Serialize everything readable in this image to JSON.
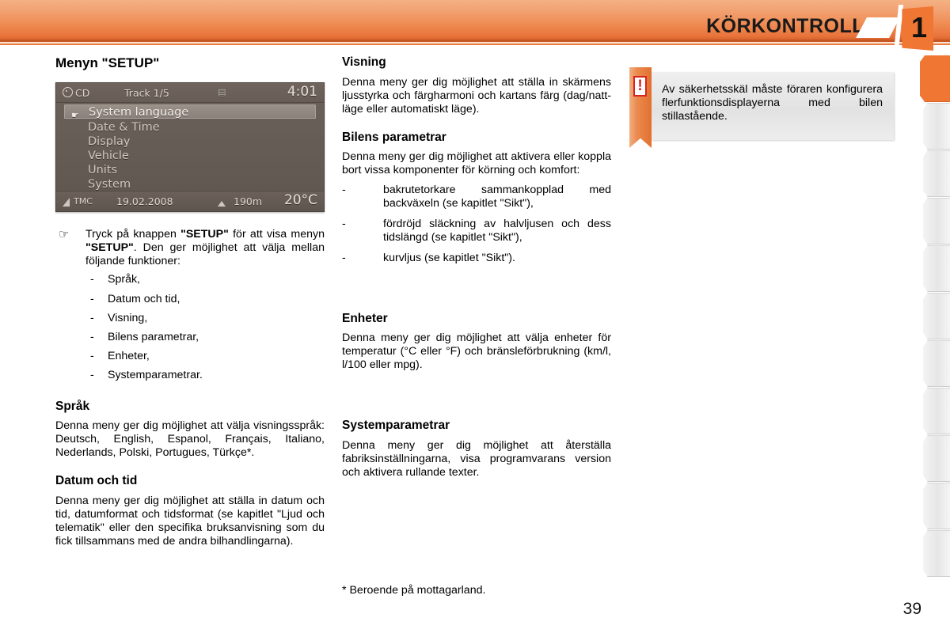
{
  "header": {
    "title": "KÖRKONTROLL",
    "chapter_number": "1",
    "accent_color": "#ef7733"
  },
  "left_column": {
    "heading": "Menyn \"SETUP\"",
    "screen": {
      "topbar": {
        "source": "CD",
        "track": "Track 1/5",
        "time": "4:01"
      },
      "menu_items": [
        "System language",
        "Date & Time",
        "Display",
        "Vehicle",
        "Units",
        "System"
      ],
      "selected_index": 0,
      "statusbar": {
        "tmc": "TMC",
        "date": "19.02.2008",
        "altitude": "190m",
        "temperature": "20°C"
      }
    },
    "pointer_paragraph": {
      "icon": "pointing-hand-icon",
      "text_parts": [
        {
          "text": "Tryck på knappen ",
          "bold": false
        },
        {
          "text": "\"SETUP\"",
          "bold": true
        },
        {
          "text": " för att visa menyn ",
          "bold": false
        },
        {
          "text": "\"SETUP\"",
          "bold": true
        },
        {
          "text": ". Den ger möjlighet att välja mellan följande funktioner:",
          "bold": false
        }
      ],
      "plain_text": "Tryck på knappen \"SETUP\" för att visa menyn \"SETUP\". Den ger möjlighet att välja mellan följande funktioner:"
    },
    "function_list": [
      "Språk,",
      "Datum och tid,",
      "Visning,",
      "Bilens parametrar,",
      "Enheter,",
      "Systemparametrar."
    ],
    "sections": [
      {
        "heading": "Språk",
        "body": "Denna meny ger dig möjlighet att välja visningsspråk: Deutsch, English, Espanol, Français, Italiano, Nederlands, Polski, Portugues, Türkçe*."
      },
      {
        "heading": "Datum och tid",
        "body": "Denna meny ger dig möjlighet att ställa in datum och tid, datumformat och tidsformat (se kapitlet \"Ljud och telematik\" eller den specifika bruksanvisning som du fick tillsammans med de andra bilhandlingarna)."
      }
    ]
  },
  "middle_column": {
    "sections": [
      {
        "heading": "Visning",
        "body": "Denna meny ger dig möjlighet att ställa in skärmens ljusstyrka och färgharmoni och kartans färg (dag/natt-läge eller automatiskt läge)."
      },
      {
        "heading": "Bilens parametrar",
        "body": "Denna meny ger dig möjlighet att aktivera eller koppla bort vissa komponenter för körning och komfort:",
        "list": [
          "bakrutetorkare sammankopplad med backväxeln (se kapitlet \"Sikt\"),",
          "fördröjd släckning av halvljusen och dess tidslängd (se kapitlet \"Sikt\"),",
          "kurvljus (se kapitlet \"Sikt\")."
        ]
      },
      {
        "heading": "Enheter",
        "body": "Denna meny ger dig möjlighet att välja enheter för temperatur (°C eller °F) och bränsleförbrukning (km/l, l/100 eller mpg)."
      },
      {
        "heading": "Systemparametrar",
        "body": "Denna meny ger dig möjlighet att återställa fabriksinställningarna, visa programvarans version och aktivera rullande texter."
      }
    ],
    "footnote": "* Beroende på mottagarland."
  },
  "right_column": {
    "warning": {
      "icon": "exclamation-icon",
      "symbol": "!",
      "text": "Av säkerhetsskäl måste föraren konfigurera flerfunktionsdisplayerna med bilen stillastående."
    }
  },
  "footer": {
    "page_number": "39"
  }
}
